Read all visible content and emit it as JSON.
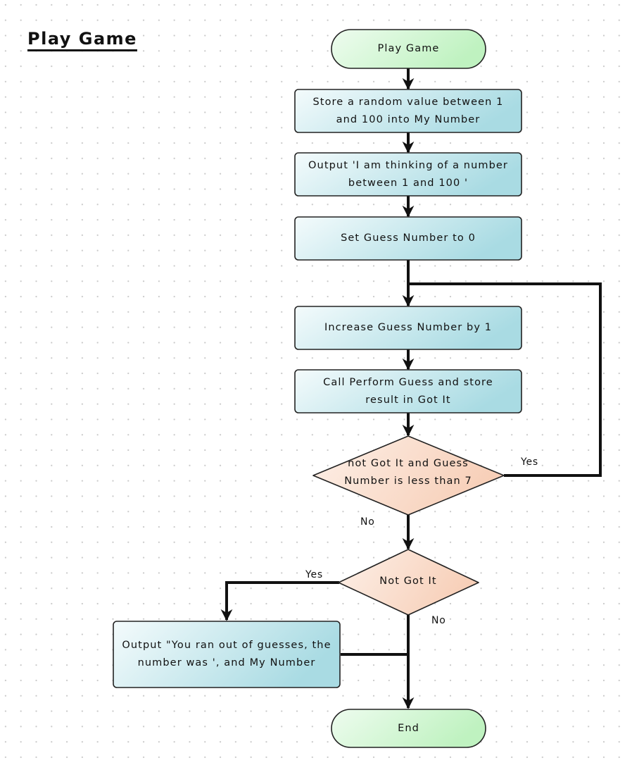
{
  "diagram": {
    "title": "Play Game",
    "colors": {
      "terminal_fill_start": "#eefcef",
      "terminal_fill_end": "#bff2c0",
      "process_fill_start": "#f4fbfc",
      "process_fill_end": "#a9dbe3",
      "decision_fill_start": "#fdf0e8",
      "decision_fill_end": "#f7cfb8",
      "stroke": "#111111"
    },
    "nodes": [
      {
        "id": "start",
        "type": "terminal",
        "text": "Play Game"
      },
      {
        "id": "store-random",
        "type": "process",
        "text": "Store a random value between 1 and 100 into My Number"
      },
      {
        "id": "output-thinking",
        "type": "process",
        "text": "Output 'I am thinking of a number between 1 and 100 '"
      },
      {
        "id": "set-guess",
        "type": "process",
        "text": "Set Guess Number to 0"
      },
      {
        "id": "increase-guess",
        "type": "process",
        "text": "Increase Guess Number by 1"
      },
      {
        "id": "call-perform",
        "type": "process",
        "text": "Call Perform Guess and store result in Got It"
      },
      {
        "id": "loop-decision",
        "type": "decision",
        "text": "not Got It and Guess Number is less than 7"
      },
      {
        "id": "not-got-it",
        "type": "decision",
        "text": "Not Got It"
      },
      {
        "id": "output-ran-out",
        "type": "process",
        "text": "Output \"You ran out of guesses, the number was ', and My Number"
      },
      {
        "id": "end",
        "type": "terminal",
        "text": "End"
      }
    ],
    "edge_labels": {
      "loop_yes": "Yes",
      "loop_no": "No",
      "notgot_yes": "Yes",
      "notgot_no": "No"
    }
  }
}
